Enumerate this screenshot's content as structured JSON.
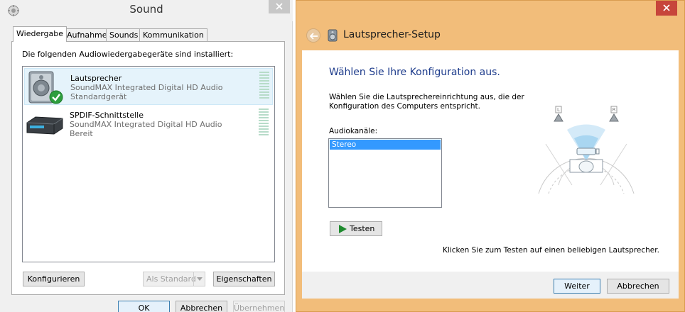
{
  "sound_dialog": {
    "title": "Sound",
    "tabs": [
      {
        "label": "Wiedergabe",
        "active": true
      },
      {
        "label": "Aufnahme",
        "active": false
      },
      {
        "label": "Sounds",
        "active": false
      },
      {
        "label": "Kommunikation",
        "active": false
      }
    ],
    "heading": "Die folgenden Audiowiedergabegeräte sind installiert:",
    "devices": [
      {
        "name": "Lautsprecher",
        "description": "SoundMAX Integrated Digital HD Audio",
        "status": "Standardgerät",
        "icon": "speaker-icon",
        "default_check": true,
        "selected": true
      },
      {
        "name": "SPDIF-Schnittstelle",
        "description": "SoundMAX Integrated Digital HD Audio",
        "status": "Bereit",
        "icon": "spdif-device-icon",
        "default_check": false,
        "selected": false
      }
    ],
    "buttons": {
      "configure": "Konfigurieren",
      "set_default": "Als Standard",
      "properties": "Eigenschaften",
      "ok": "OK",
      "cancel": "Abbrechen",
      "apply": "Übernehmen"
    }
  },
  "setup_dialog": {
    "title": "Lautsprecher-Setup",
    "heading": "Wählen Sie Ihre Konfiguration aus.",
    "instruction": "Wählen Sie die Lautsprechereinrichtung aus, die der Konfiguration des Computers entspricht.",
    "channels_label": "Audiokanäle:",
    "channels": [
      "Stereo"
    ],
    "selected_channel": "Stereo",
    "test_button": "Testen",
    "hint": "Klicken Sie zum Testen auf einen beliebigen Lautsprecher.",
    "speaker_labels": {
      "left": "L",
      "right": "R"
    },
    "buttons": {
      "next": "Weiter",
      "cancel": "Abbrechen"
    }
  },
  "colors": {
    "setup_frame": "#f2bd7a",
    "heading_blue": "#1e3c8c",
    "selection": "#3399ff",
    "close_red": "#c7453b"
  }
}
